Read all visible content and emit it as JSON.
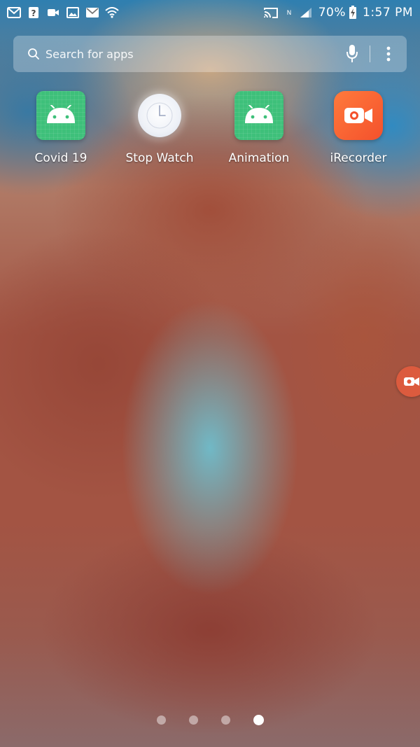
{
  "status_bar": {
    "left_icons": [
      "gmail-icon",
      "question-icon",
      "video-icon",
      "gallery-icon",
      "mail-icon",
      "wifi-icon"
    ],
    "right_icons": [
      "cast-icon",
      "nfc-icon",
      "signal-icon"
    ],
    "battery": "70%",
    "time": "1:57 PM"
  },
  "search": {
    "placeholder": "Search for apps"
  },
  "apps": [
    {
      "label": "Covid 19",
      "icon": "android-icon",
      "color": "#3ec07a"
    },
    {
      "label": "Stop Watch",
      "icon": "clock-icon",
      "color": "#eef1f7"
    },
    {
      "label": "Animation",
      "icon": "android-icon",
      "color": "#3ec07a"
    },
    {
      "label": "iRecorder",
      "icon": "video-camera-icon",
      "color": "#f4512c"
    }
  ],
  "page_indicator": {
    "count": 4,
    "active_index": 3
  }
}
